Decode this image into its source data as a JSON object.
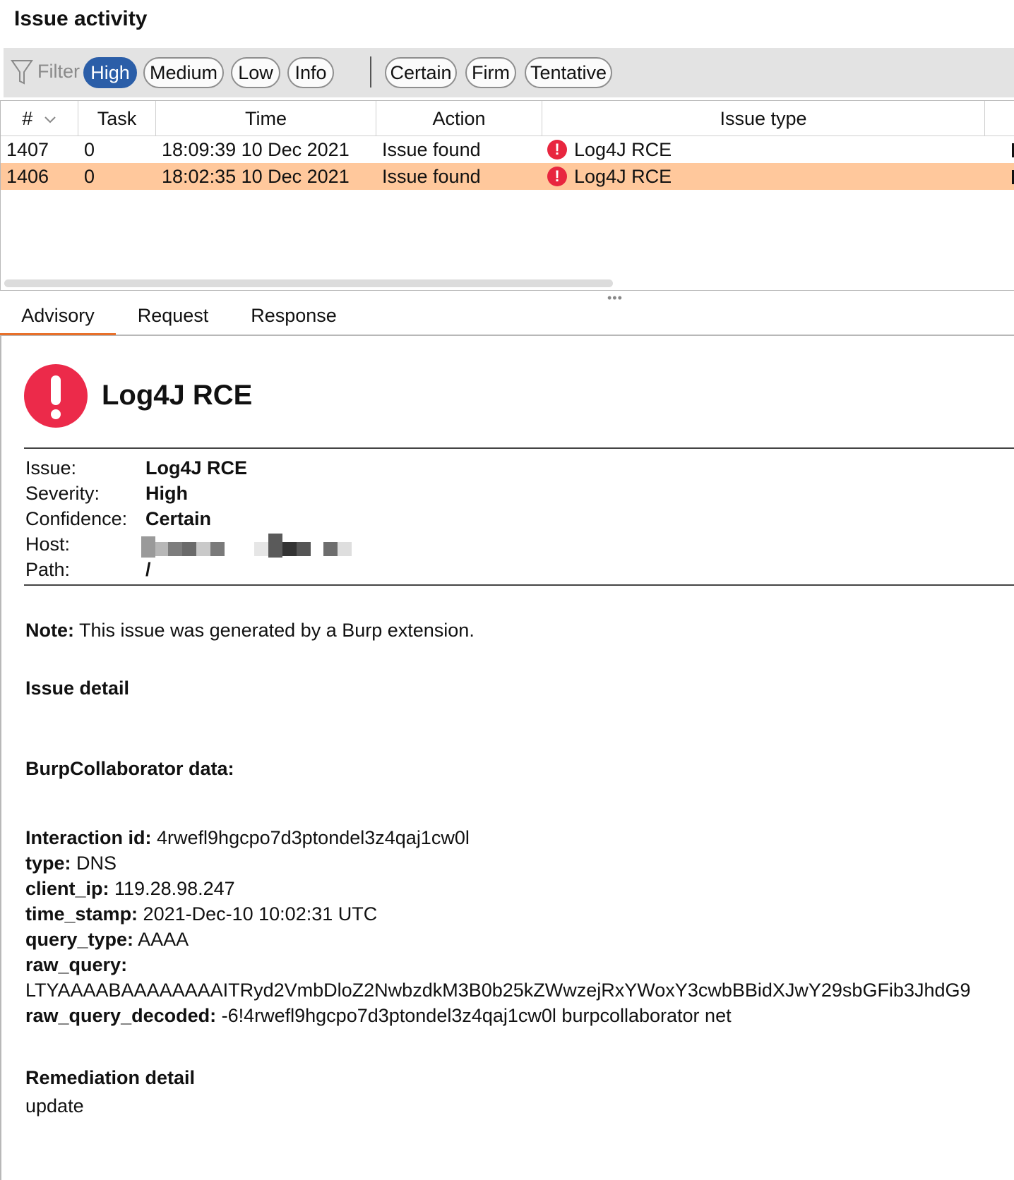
{
  "header": {
    "title": "Issue activity"
  },
  "filter": {
    "label": "Filter",
    "severity_chips": [
      "High",
      "Medium",
      "Low",
      "Info"
    ],
    "confidence_chips": [
      "Certain",
      "Firm",
      "Tentative"
    ],
    "active": [
      "High"
    ]
  },
  "table": {
    "columns": [
      "#",
      "Task",
      "Time",
      "Action",
      "Issue type"
    ],
    "rows": [
      {
        "id": "1407",
        "task": "0",
        "time": "18:09:39 10 Dec 2021",
        "action": "Issue found",
        "issue_type": "Log4J RCE",
        "selected": false
      },
      {
        "id": "1406",
        "task": "0",
        "time": "18:02:35 10 Dec 2021",
        "action": "Issue found",
        "issue_type": "Log4J RCE",
        "selected": true
      }
    ]
  },
  "tabs": [
    "Advisory",
    "Request",
    "Response"
  ],
  "advisory": {
    "title": "Log4J RCE",
    "fields": {
      "issue_label": "Issue:",
      "issue": "Log4J RCE",
      "severity_label": "Severity:",
      "severity": "High",
      "confidence_label": "Confidence:",
      "confidence": "Certain",
      "host_label": "Host:",
      "path_label": "Path:",
      "path": "/"
    },
    "note_label": "Note:",
    "note": " This issue was generated by a Burp extension.",
    "issue_detail_heading": "Issue detail",
    "collab_heading": "BurpCollaborator data:",
    "interaction": {
      "id_label": "Interaction id:",
      "id": " 4rwefl9hgcpo7d3ptondel3z4qaj1cw0l",
      "type_label": "type:",
      "type": " DNS",
      "client_ip_label": "client_ip:",
      "client_ip": " 119.28.98.247",
      "time_stamp_label": "time_stamp:",
      "time_stamp": " 2021-Dec-10 10:02:31 UTC",
      "query_type_label": "query_type:",
      "query_type": " AAAA",
      "raw_query_label": "raw_query:",
      "raw_query": "LTYAAAABAAAAAAAAITRyd2VmbDloZ2NwbzdkM3B0b25kZWwzejRxYWoxY3cwbBBidXJwY29sbGFib3JhdG9",
      "raw_query_decoded_label": "raw_query_decoded:",
      "raw_query_decoded": " -6!4rwefl9hgcpo7d3ptondel3z4qaj1cw0l burpcollaborator net"
    },
    "remediation_heading": "Remediation detail",
    "remediation": "update"
  },
  "colors": {
    "high": "#e8263f",
    "selected_row": "#ffc89c",
    "active_chip": "#2b5ea8",
    "active_tab": "#e8702a"
  },
  "icons": [
    "filter-funnel-icon",
    "sort-chevron-icon",
    "severity-high-icon"
  ]
}
